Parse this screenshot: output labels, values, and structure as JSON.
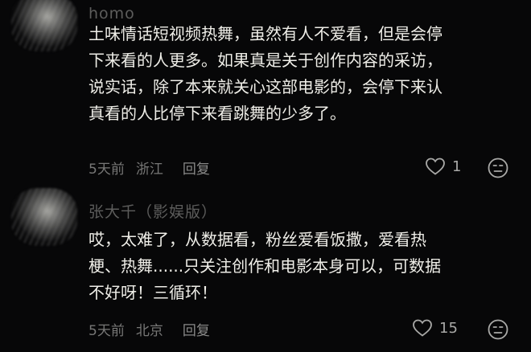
{
  "comments": [
    {
      "username": "homo",
      "text": "土味情话短视频热舞，虽然有人不爱看，但是会停\n下来看的人更多。如果真是关于创作内容的采访，\n说实话，除了本来就关心这部电影的，会停下来认\n真看的人比停下来看跳舞的少多了。",
      "time": "5天前",
      "location": "浙江",
      "reply_label": "回复",
      "like_count": "1"
    },
    {
      "username": "张大千（影娱版）",
      "text": "哎，太难了，从数据看，粉丝爱看饭撒，爱看热\n梗、热舞......只关注创作和电影本身可以，可数据\n不好呀！三循环！",
      "time": "5天前",
      "location": "北京",
      "reply_label": "回复",
      "like_count": "15"
    }
  ],
  "icons": {
    "like": "heart-outline-icon",
    "dislike": "meh-face-icon"
  },
  "colors": {
    "background": "#070708",
    "text": "#efeee8",
    "meta": "#777776"
  }
}
